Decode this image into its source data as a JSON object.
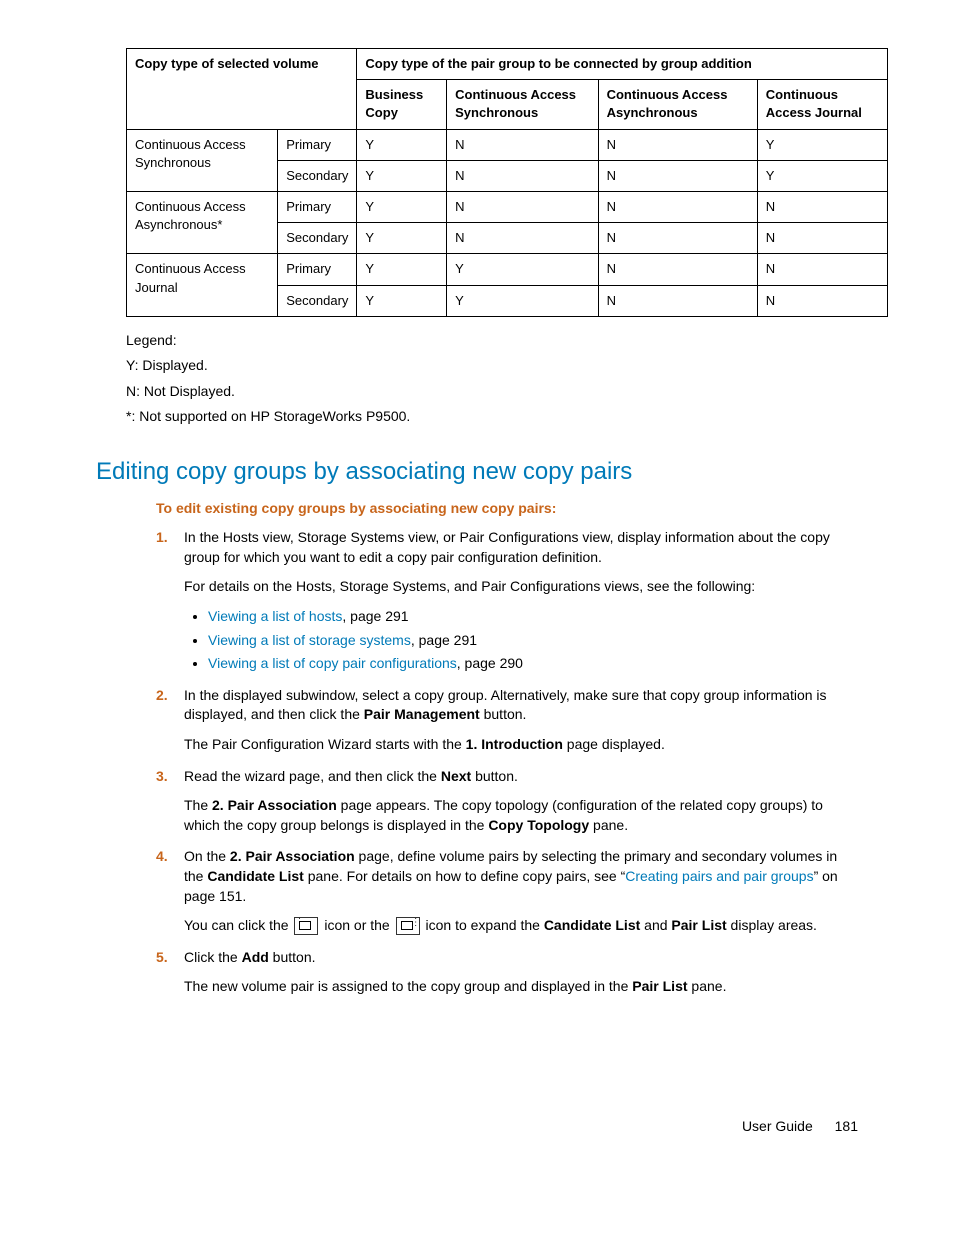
{
  "table": {
    "header_super": "Copy type of the pair group to be connected by group addition",
    "header_left": "Copy type of selected volume",
    "cols": [
      "Business Copy",
      "Continuous Access Synchronous",
      "Continuous Access Asynchronous",
      "Continuous Access Journal"
    ],
    "rows": [
      {
        "type": "Continuous Access Synchronous",
        "role": "Primary",
        "vals": [
          "Y",
          "N",
          "N",
          "Y"
        ]
      },
      {
        "type_cont": true,
        "role": "Secondary",
        "vals": [
          "Y",
          "N",
          "N",
          "Y"
        ]
      },
      {
        "type": "Continuous Access Asynchronous*",
        "role": "Primary",
        "vals": [
          "Y",
          "N",
          "N",
          "N"
        ]
      },
      {
        "type_cont": true,
        "role": "Secondary",
        "vals": [
          "Y",
          "N",
          "N",
          "N"
        ]
      },
      {
        "type": "Continuous Access Journal",
        "role": "Primary",
        "vals": [
          "Y",
          "Y",
          "N",
          "N"
        ]
      },
      {
        "type_cont": true,
        "role": "Secondary",
        "vals": [
          "Y",
          "Y",
          "N",
          "N"
        ]
      }
    ]
  },
  "legend": {
    "title": "Legend:",
    "y": "Y: Displayed.",
    "n": "N: Not Displayed.",
    "star": "*: Not supported on HP StorageWorks P9500."
  },
  "section": {
    "title": "Editing copy groups by associating new copy pairs",
    "subhead": "To edit existing copy groups by associating new copy pairs:"
  },
  "steps": {
    "s1a": "In the Hosts view, Storage Systems view, or Pair Configurations view, display information about the copy group for which you want to edit a copy pair configuration definition.",
    "s1b": "For details on the Hosts, Storage Systems, and Pair Configurations views, see the following:",
    "link1": "Viewing a list of hosts",
    "link1p": ", page 291",
    "link2": "Viewing a list of storage systems",
    "link2p": ", page 291",
    "link3": "Viewing a list of copy pair configurations",
    "link3p": ", page 290",
    "s2a_pre": "In the displayed subwindow, select a copy group. Alternatively, make sure that copy group information is displayed, and then click the ",
    "s2a_b": "Pair Management",
    "s2a_post": " button.",
    "s2b_pre": "The Pair Configuration Wizard starts with the ",
    "s2b_b": "1. Introduction",
    "s2b_post": " page displayed.",
    "s3a_pre": "Read the wizard page, and then click the ",
    "s3a_b": "Next",
    "s3a_post": " button.",
    "s3b_pre": "The ",
    "s3b_b1": "2. Pair Association",
    "s3b_mid": " page appears. The copy topology (configuration of the related copy groups) to which the copy group belongs is displayed in the ",
    "s3b_b2": "Copy Topology",
    "s3b_post": " pane.",
    "s4a_pre": "On the ",
    "s4a_b1": "2. Pair Association",
    "s4a_mid1": " page, define volume pairs by selecting the primary and secondary volumes in the ",
    "s4a_b2": "Candidate List",
    "s4a_mid2": " pane. For details on how to define copy pairs, see “",
    "s4a_link": "Creating pairs and pair groups",
    "s4a_post": "” on page 151.",
    "s4b_pre": "You can click the ",
    "s4b_mid": " icon or the ",
    "s4b_mid2": " icon to expand the ",
    "s4b_b1": "Candidate List",
    "s4b_and": " and ",
    "s4b_b2": "Pair List",
    "s4b_post": " display areas.",
    "s5a_pre": "Click the ",
    "s5a_b": "Add",
    "s5a_post": " button.",
    "s5b_pre": "The new volume pair is assigned to the copy group and displayed in the ",
    "s5b_b": "Pair List",
    "s5b_post": " pane."
  },
  "nums": {
    "n1": "1.",
    "n2": "2.",
    "n3": "3.",
    "n4": "4.",
    "n5": "5."
  },
  "footer": {
    "label": "User Guide",
    "page": "181"
  }
}
